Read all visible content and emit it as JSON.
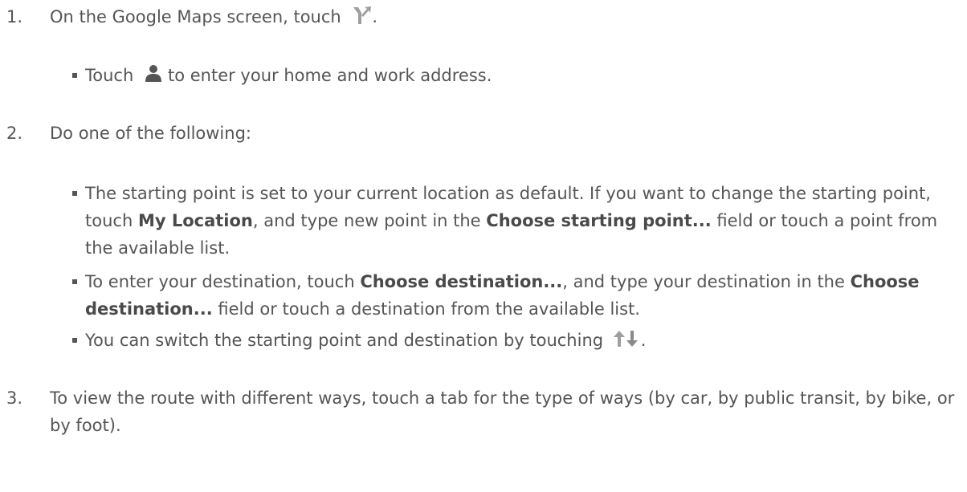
{
  "steps": [
    {
      "number": "1.",
      "text_before": "On the Google Maps screen, touch",
      "icon": "directions-icon",
      "text_after": ".",
      "bullets": [
        {
          "text_before": "Touch",
          "icon": "person-icon",
          "text_after": "to enter your home and work address."
        }
      ]
    },
    {
      "number": "2.",
      "text": "Do one of the following:",
      "bullets": [
        {
          "t1": "The starting point is set to your current location as default. If you want to change the starting point, touch ",
          "b1": "My Location",
          "t2": ", and type new point in the ",
          "b2": "Choose starting point...",
          "t3": " field or touch a point from the available list."
        },
        {
          "t1": "To enter your destination, touch ",
          "b1": "Choose destination...",
          "t2": ", and type your destination in the ",
          "b2": "Choose destination...",
          "t3": " field or touch a destination from the available list."
        },
        {
          "text_before": "You can switch the starting point and destination by touching",
          "icon": "swap-arrows-icon",
          "text_after": "."
        }
      ]
    },
    {
      "number": "3.",
      "text": "To view the route with different ways, touch a tab for the type of ways (by car, by public transit, by bike, or by foot)."
    }
  ],
  "colors": {
    "text": "#555555",
    "icon": "#9e9e9e"
  }
}
